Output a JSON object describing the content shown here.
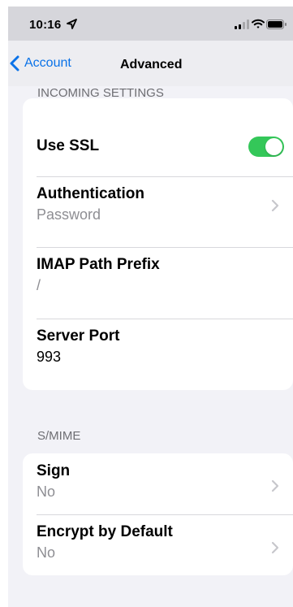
{
  "status_bar": {
    "time": "10:16",
    "icons": [
      "location-arrow-icon",
      "cellular-signal-icon",
      "wifi-icon",
      "battery-icon"
    ]
  },
  "nav": {
    "back_label": "Account",
    "title": "Advanced",
    "back_icon": "chevron-left-icon"
  },
  "incoming": {
    "header": "INCOMING SETTINGS",
    "use_ssl": {
      "label": "Use SSL",
      "enabled": true
    },
    "authentication": {
      "label": "Authentication",
      "value": "Password"
    },
    "imap_path_prefix": {
      "label": "IMAP Path Prefix",
      "placeholder": "/"
    },
    "server_port": {
      "label": "Server Port",
      "value": "993"
    }
  },
  "smime": {
    "header": "S/MIME",
    "sign": {
      "label": "Sign",
      "value": "No"
    },
    "encrypt_by_default": {
      "label": "Encrypt by Default",
      "value": "No"
    }
  },
  "colors": {
    "accent": "#0a72e8",
    "toggle_on": "#34c759",
    "background": "#f2f2f7",
    "secondary_text": "#8e8e93"
  }
}
